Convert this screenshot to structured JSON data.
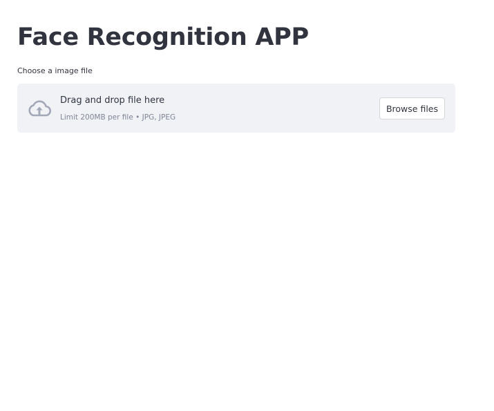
{
  "app": {
    "title": "Face Recognition APP"
  },
  "uploader": {
    "label": "Choose a image file",
    "dropzone": {
      "icon": "cloud-upload-icon",
      "title": "Drag and drop file here",
      "subtitle": "Limit 200MB per file • JPG, JPEG"
    },
    "browse_label": "Browse files"
  },
  "colors": {
    "text": "#31333f",
    "muted_text": "#808495",
    "dropzone_bg": "#f0f2f6",
    "icon": "#a3a8b8",
    "button_border": "#d6d6d9"
  }
}
